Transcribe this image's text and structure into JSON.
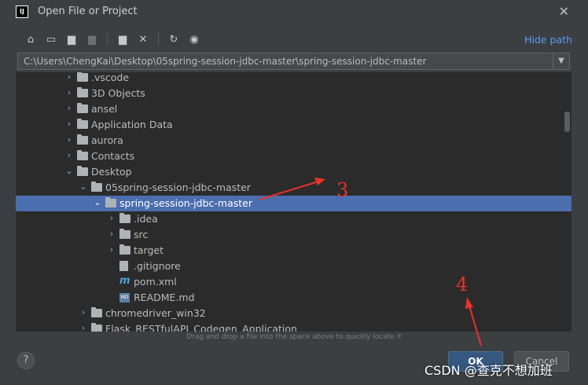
{
  "window": {
    "title": "Open File or Project",
    "app_icon_text": "IJ"
  },
  "toolbar": {
    "buttons": [
      "home-icon",
      "desktop-icon",
      "project-folder-icon",
      "module-folder-icon",
      "new-folder-icon",
      "delete-icon",
      "refresh-icon",
      "show-hidden-icon"
    ],
    "hide_path": "Hide path"
  },
  "path": {
    "value": "C:\\Users\\ChengKai\\Desktop\\05spring-session-jdbc-master\\spring-session-jdbc-master"
  },
  "tree": [
    {
      "label": ".vscode",
      "depth": 0,
      "icon": "folder",
      "expanded": false
    },
    {
      "label": "3D Objects",
      "depth": 0,
      "icon": "folder",
      "expanded": false
    },
    {
      "label": "ansel",
      "depth": 0,
      "icon": "folder",
      "expanded": false
    },
    {
      "label": "Application Data",
      "depth": 0,
      "icon": "folder-link",
      "expanded": false
    },
    {
      "label": "aurora",
      "depth": 0,
      "icon": "folder",
      "expanded": false
    },
    {
      "label": "Contacts",
      "depth": 0,
      "icon": "folder",
      "expanded": false
    },
    {
      "label": "Desktop",
      "depth": 0,
      "icon": "folder",
      "expanded": true
    },
    {
      "label": "05spring-session-jdbc-master",
      "depth": 1,
      "icon": "folder",
      "expanded": true
    },
    {
      "label": "spring-session-jdbc-master",
      "depth": 2,
      "icon": "project-folder",
      "expanded": true,
      "selected": true
    },
    {
      "label": ".idea",
      "depth": 3,
      "icon": "folder",
      "expanded": false
    },
    {
      "label": "src",
      "depth": 3,
      "icon": "folder",
      "expanded": false
    },
    {
      "label": "target",
      "depth": 3,
      "icon": "folder",
      "expanded": false
    },
    {
      "label": ".gitignore",
      "depth": 3,
      "icon": "file",
      "leaf": true
    },
    {
      "label": "pom.xml",
      "depth": 3,
      "icon": "maven",
      "leaf": true
    },
    {
      "label": "README.md",
      "depth": 3,
      "icon": "markdown",
      "leaf": true
    },
    {
      "label": "chromedriver_win32",
      "depth": 1,
      "icon": "folder",
      "expanded": false
    },
    {
      "label": "Flask_RESTfulAPI_Codegen_Application",
      "depth": 1,
      "icon": "folder",
      "expanded": false
    }
  ],
  "hint": "Drag and drop a file into the space above to quickly locate it",
  "buttons": {
    "help": "?",
    "ok": "OK",
    "cancel": "Cancel"
  },
  "annotations": {
    "step3": "3",
    "step4": "4"
  },
  "watermark": "CSDN @查克不想加班",
  "colors": {
    "selection": "#4b6eaf",
    "link": "#589df6",
    "annotation": "#e8322c"
  }
}
